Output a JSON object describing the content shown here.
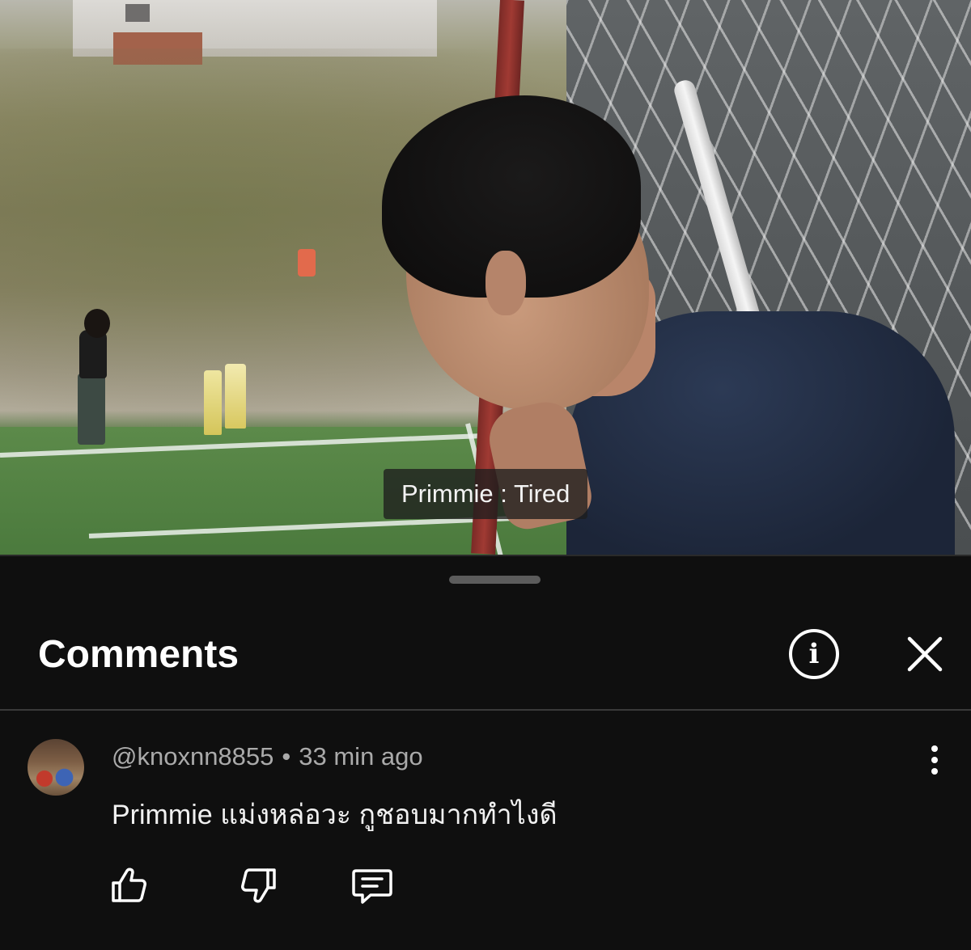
{
  "video": {
    "caption": "Primmie : Tired"
  },
  "comments_panel": {
    "title": "Comments",
    "info_icon": "info-circle-icon",
    "close_icon": "close-icon"
  },
  "comments": [
    {
      "author": "@knoxnn8855",
      "separator": "•",
      "time": "33 min ago",
      "text": "Primmie แม่งหล่อวะ กูชอบมากทำไงดี",
      "actions": {
        "like_icon": "thumbs-up-icon",
        "dislike_icon": "thumbs-down-icon",
        "reply_icon": "reply-icon"
      }
    }
  ],
  "colors": {
    "background": "#0f0f0f",
    "text_primary": "#f1f1f1",
    "text_secondary": "#aaaaaa"
  }
}
